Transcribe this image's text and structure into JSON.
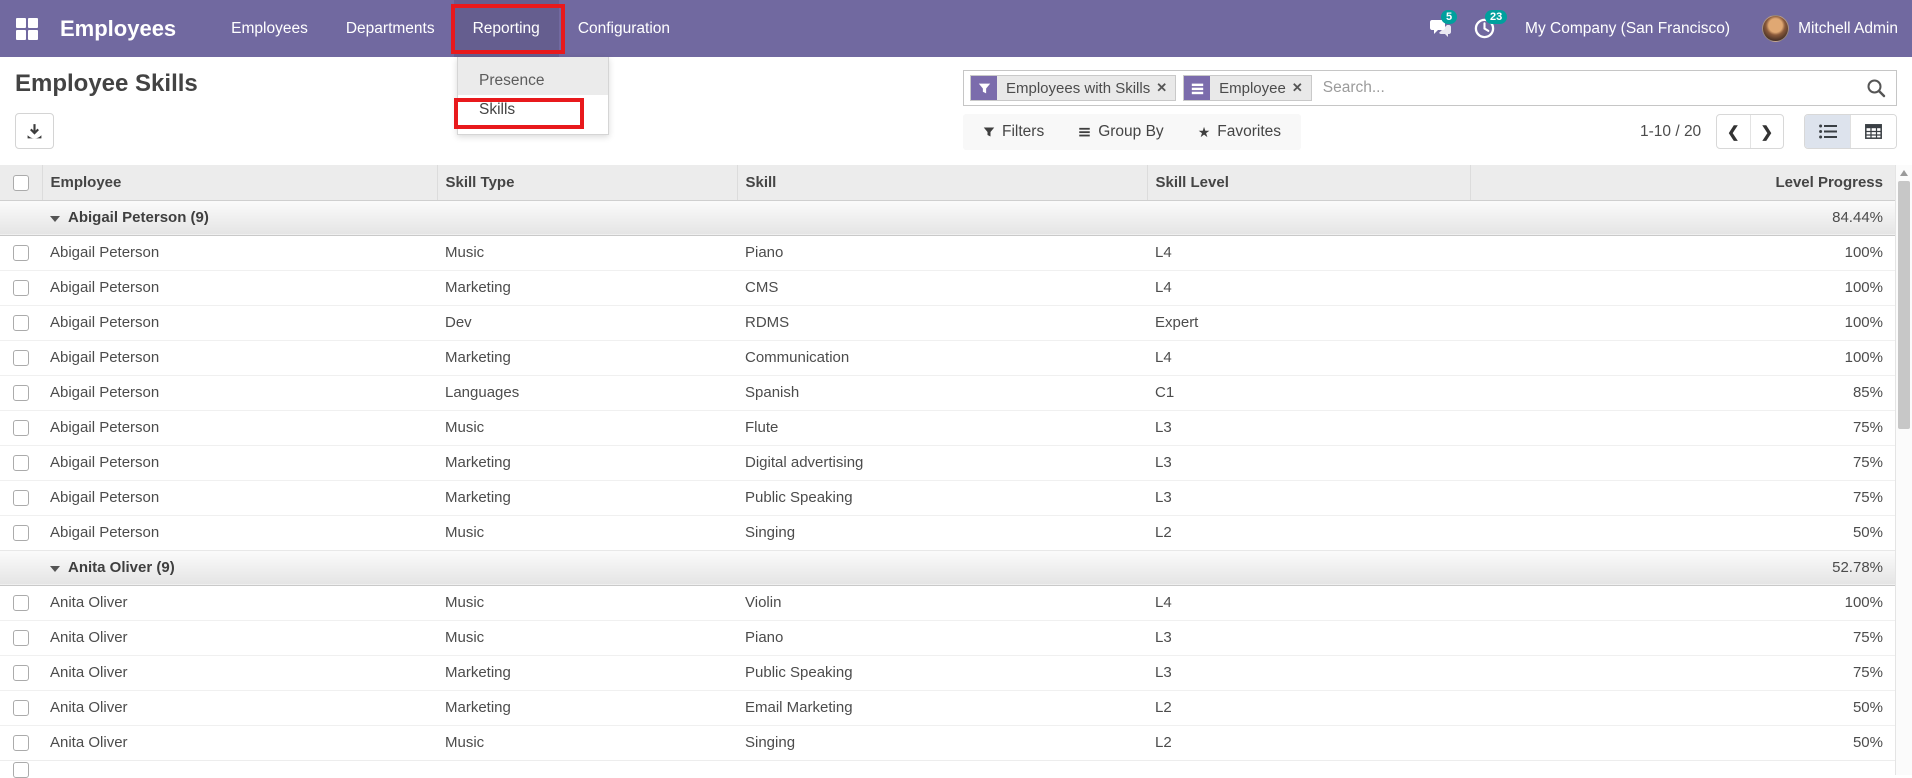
{
  "colors": {
    "navbar_bg": "#7169a0",
    "facet_bg": "#7b6cac",
    "badge": "#00a09d",
    "annotation_red": "#e8191c",
    "active_view_bg": "#dde3ed"
  },
  "navbar": {
    "brand": "Employees",
    "menus": [
      {
        "label": "Employees"
      },
      {
        "label": "Departments"
      },
      {
        "label": "Reporting"
      },
      {
        "label": "Configuration"
      }
    ],
    "messages_badge": "5",
    "activities_badge": "23",
    "company": "My Company (San Francisco)",
    "user": "Mitchell Admin",
    "icons": [
      "apps-grid-icon",
      "chat-icon",
      "activity-clock-icon",
      "avatar"
    ]
  },
  "reporting_dropdown": {
    "items": [
      {
        "label": "Presence"
      },
      {
        "label": "Skills",
        "highlighted": true
      }
    ]
  },
  "page": {
    "title": "Employee Skills",
    "export_icon": "download-icon"
  },
  "search": {
    "facets": [
      {
        "icon": "filter-icon",
        "label": "Employees with Skills",
        "remove": "✕"
      },
      {
        "icon": "group-by-icon",
        "label": "Employee",
        "remove": "✕"
      }
    ],
    "placeholder": "Search...",
    "search_icon": "magnifier-icon"
  },
  "toolbar": {
    "filters_label": "Filters",
    "group_by_label": "Group By",
    "favorites_label": "Favorites",
    "pager_text": "1-10 / 20",
    "views": [
      "list-view-icon",
      "grid-view-icon"
    ],
    "active_view": "list"
  },
  "table": {
    "columns": [
      "Employee",
      "Skill Type",
      "Skill",
      "Skill Level",
      "Level Progress"
    ],
    "groups": [
      {
        "name": "Abigail Peterson (9)",
        "progress": "84.44%",
        "rows": [
          {
            "employee": "Abigail Peterson",
            "skill_type": "Music",
            "skill": "Piano",
            "skill_level": "L4",
            "progress": "100%"
          },
          {
            "employee": "Abigail Peterson",
            "skill_type": "Marketing",
            "skill": "CMS",
            "skill_level": "L4",
            "progress": "100%"
          },
          {
            "employee": "Abigail Peterson",
            "skill_type": "Dev",
            "skill": "RDMS",
            "skill_level": "Expert",
            "progress": "100%"
          },
          {
            "employee": "Abigail Peterson",
            "skill_type": "Marketing",
            "skill": "Communication",
            "skill_level": "L4",
            "progress": "100%"
          },
          {
            "employee": "Abigail Peterson",
            "skill_type": "Languages",
            "skill": "Spanish",
            "skill_level": "C1",
            "progress": "85%"
          },
          {
            "employee": "Abigail Peterson",
            "skill_type": "Music",
            "skill": "Flute",
            "skill_level": "L3",
            "progress": "75%"
          },
          {
            "employee": "Abigail Peterson",
            "skill_type": "Marketing",
            "skill": "Digital advertising",
            "skill_level": "L3",
            "progress": "75%"
          },
          {
            "employee": "Abigail Peterson",
            "skill_type": "Marketing",
            "skill": "Public Speaking",
            "skill_level": "L3",
            "progress": "75%"
          },
          {
            "employee": "Abigail Peterson",
            "skill_type": "Music",
            "skill": "Singing",
            "skill_level": "L2",
            "progress": "50%"
          }
        ]
      },
      {
        "name": "Anita Oliver (9)",
        "progress": "52.78%",
        "rows": [
          {
            "employee": "Anita Oliver",
            "skill_type": "Music",
            "skill": "Violin",
            "skill_level": "L4",
            "progress": "100%"
          },
          {
            "employee": "Anita Oliver",
            "skill_type": "Music",
            "skill": "Piano",
            "skill_level": "L3",
            "progress": "75%"
          },
          {
            "employee": "Anita Oliver",
            "skill_type": "Marketing",
            "skill": "Public Speaking",
            "skill_level": "L3",
            "progress": "75%"
          },
          {
            "employee": "Anita Oliver",
            "skill_type": "Marketing",
            "skill": "Email Marketing",
            "skill_level": "L2",
            "progress": "50%"
          },
          {
            "employee": "Anita Oliver",
            "skill_type": "Music",
            "skill": "Singing",
            "skill_level": "L2",
            "progress": "50%"
          }
        ]
      }
    ],
    "partial_row": true
  }
}
